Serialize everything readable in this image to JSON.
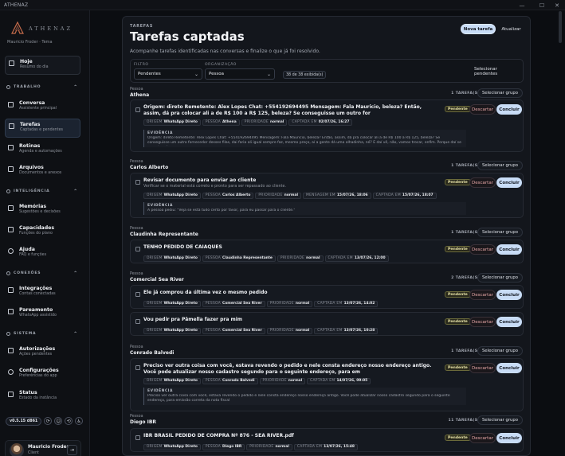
{
  "window": {
    "title": "ATHENAZ"
  },
  "sidebar": {
    "brand": "ATHENAZ",
    "user_line": "Mauricio Froder · Tema",
    "nav": [
      {
        "label": "Hoje",
        "sub": "Resumo do dia",
        "icon": "home-icon",
        "active": false
      },
      {
        "label": "Conversa",
        "sub": "Assistente principal",
        "icon": "chat-icon",
        "active": false
      },
      {
        "label": "Tarefas",
        "sub": "Captadas e pendentes",
        "icon": "tasks-icon",
        "active": true
      },
      {
        "label": "Rotinas",
        "sub": "Agenda e automações",
        "icon": "calendar-icon",
        "active": false
      },
      {
        "label": "Arquivos",
        "sub": "Documentos e anexos",
        "icon": "folder-icon",
        "active": false
      },
      {
        "label": "Memórias",
        "sub": "Sugestões e decisões",
        "icon": "memory-icon",
        "active": false
      },
      {
        "label": "Capacidades",
        "sub": "Funções do plano",
        "icon": "capabilities-icon",
        "active": false
      },
      {
        "label": "Ajuda",
        "sub": "FAQ e funções",
        "icon": "help-icon",
        "active": false
      },
      {
        "label": "Integrações",
        "sub": "Contas conectadas",
        "icon": "integrations-icon",
        "active": false
      },
      {
        "label": "Pareamento",
        "sub": "WhatsApp assistido",
        "icon": "link-icon",
        "active": false
      },
      {
        "label": "Autorizações",
        "sub": "Ações pendentes",
        "icon": "key-icon",
        "active": false
      },
      {
        "label": "Configurações",
        "sub": "Preferências do app",
        "icon": "gear-icon",
        "active": false
      },
      {
        "label": "Status",
        "sub": "Estado da instância",
        "icon": "status-icon",
        "active": false
      }
    ],
    "sections": {
      "trabalho": "TRABALHO",
      "inteligencia": "INTELIGÊNCIA",
      "conexoes": "CONEXÕES",
      "sistema": "SISTEMA"
    },
    "version": "v0.5.15 d861",
    "user": {
      "name": "Mauricio Froder",
      "role": "Client"
    }
  },
  "header": {
    "eyebrow": "TAREFAS",
    "title": "Tarefas captadas",
    "description": "Acompanhe tarefas identificadas nas conversas e finalize o que já foi resolvido.",
    "new_task": "Nova tarefa",
    "refresh": "Atualizar"
  },
  "filters": {
    "filter_label": "FILTRO",
    "filter_value": "Pendentes",
    "group_label": "ORGANIZAÇÃO",
    "group_value": "Pessoa",
    "count": "38 de 38 exibida(s)",
    "select_pending": "Selecionar pendentes"
  },
  "labels": {
    "person": "Pessoa",
    "select_group": "Selecionar grupo",
    "discard": "Descartar",
    "conclude": "Concluir",
    "evidence": "EVIDÊNCIA",
    "origin": "ORIGEM",
    "person_key": "PESSOA",
    "priority": "PRIORIDADE",
    "captured": "CAPTADA EM",
    "message": "MENSAGEM EM"
  },
  "groups": [
    {
      "name": "Athena",
      "count": "1 TAREFA(S)",
      "tasks": [
        {
          "title": "Origem: direto Remetente: Alex Lopes Chat: +554192694495 Mensagem: Fala Mauricio, beleza? Então, assim, dá pra colocar ali a de R$ 100 a R$ 125, beleza? Se conseguisse um outro for",
          "status": "Pendente",
          "origin": "WhatsApp Direto",
          "person": "Athena",
          "priority": "normal",
          "captured": "02/07/26, 16:27",
          "evidence": "Origem: direto Remetente: Alex Lopes Chat: +554192694495 Mensagem: Fala Mauricio, beleza? Então, assim, dá pra colocar ali a de R$ 100 a R$ 125, beleza? Se conseguisse um outro fornecedor desses filas, dai faria ali igual sempre faz, mesmo preço, aí a gente dá uma olhadinha, né? E daí vê, não, vamos trocar, enfim. Porque daí se a gente achasse u..."
        }
      ]
    },
    {
      "name": "Carlos Alberto",
      "count": "1 TAREFA(S)",
      "tasks": [
        {
          "title": "Revisar documento para enviar ao cliente",
          "sub": "Verificar se o material está correto e pronto para ser repassado ao cliente.",
          "status": "Pendente",
          "origin": "WhatsApp Direto",
          "person": "Carlos Alberto",
          "priority": "normal",
          "message_at": "15/07/26, 18:06",
          "captured": "15/07/26, 18:07",
          "evidence": "A pessoa pediu: \"Veja se está tudo certo por favor, para eu passar para o cliente.\""
        }
      ]
    },
    {
      "name": "Claudinha Representante",
      "count": "1 TAREFA(S)",
      "tasks": [
        {
          "title": "TENHO PEDIDO DE CAIAQUES",
          "status": "Pendente",
          "origin": "WhatsApp Direto",
          "person": "Claudinha Representante",
          "priority": "normal",
          "captured": "13/07/26, 12:00"
        }
      ]
    },
    {
      "name": "Comercial Sea River",
      "count": "2 TAREFA(S)",
      "tasks": [
        {
          "title": "Ele já comprou da última vez o mesmo pedido",
          "status": "Pendente",
          "origin": "WhatsApp Direto",
          "person": "Comercial Sea River",
          "priority": "normal",
          "captured": "13/07/26, 14:02"
        },
        {
          "title": "Vou pedir pra Pâmella fazer pra mim",
          "status": "Pendente",
          "origin": "WhatsApp Direto",
          "person": "Comercial Sea River",
          "priority": "normal",
          "captured": "13/07/26, 10:28"
        }
      ]
    },
    {
      "name": "Conrado Balvedi",
      "count": "1 TAREFA(S)",
      "tasks": [
        {
          "title": "Preciso ver outra coisa com você, estava revendo o pedido e nele consta endereço nosso endereço antigo. Você pode atualizar nosso cadastro segundo para o seguinte endereço, para em",
          "status": "Pendente",
          "origin": "WhatsApp Direto",
          "person": "Conrado Balvedi",
          "priority": "normal",
          "captured": "14/07/26, 09:05",
          "evidence": "Preciso ver outra coisa com você, estava revendo o pedido e nele consta endereço nosso endereço antigo. Você pode atualizar nosso cadastro segundo para o seguinte endereço, para emissão correta da nota fiscal"
        }
      ]
    },
    {
      "name": "Diego IBR",
      "count": "11 TAREFA(S)",
      "tasks": [
        {
          "title": "IBR BRASIL PEDIDO DE COMPRA Nº 876 - SEA RIVER.pdf",
          "status": "Pendente",
          "origin": "WhatsApp Direto",
          "person": "Diego IBR",
          "priority": "normal",
          "captured": "13/07/26, 15:48"
        }
      ]
    }
  ]
}
